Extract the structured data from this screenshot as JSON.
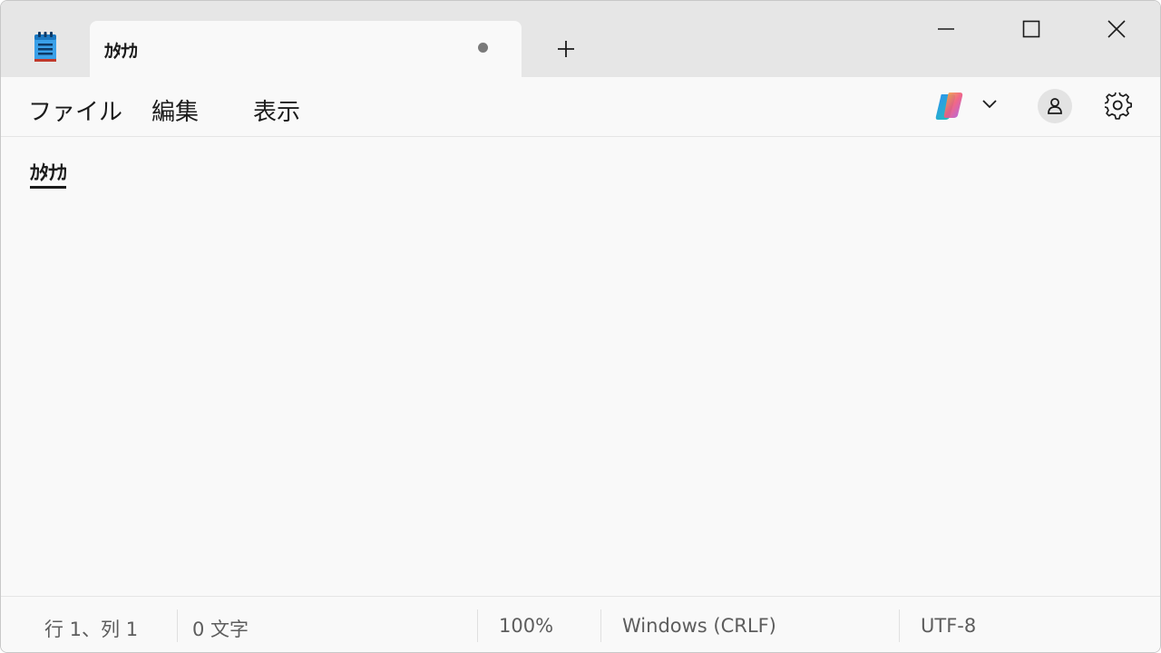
{
  "tab": {
    "title": "ｶﾀﾅｶ"
  },
  "menu": {
    "file": "ファイル",
    "edit": "編集",
    "view": "表示"
  },
  "editor": {
    "content": "ｶﾀﾅｶ"
  },
  "status": {
    "position": "行 1、列 1",
    "char_count": "0 文字",
    "zoom": "100%",
    "line_ending": "Windows (CRLF)",
    "encoding": "UTF-8"
  },
  "icons": {
    "app": "notepad-icon",
    "tab_unsaved": "unsaved-dot-icon",
    "new_tab": "plus-icon",
    "minimize": "minimize-icon",
    "maximize": "maximize-icon",
    "close": "close-icon",
    "copilot": "copilot-icon",
    "copilot_menu": "chevron-down-icon",
    "account": "account-icon",
    "settings": "gear-icon"
  },
  "colors": {
    "titlebar": "#e6e6e6",
    "surface": "#f9f9f9",
    "text": "#1b1b1b",
    "status_text": "#5d5d5d"
  }
}
